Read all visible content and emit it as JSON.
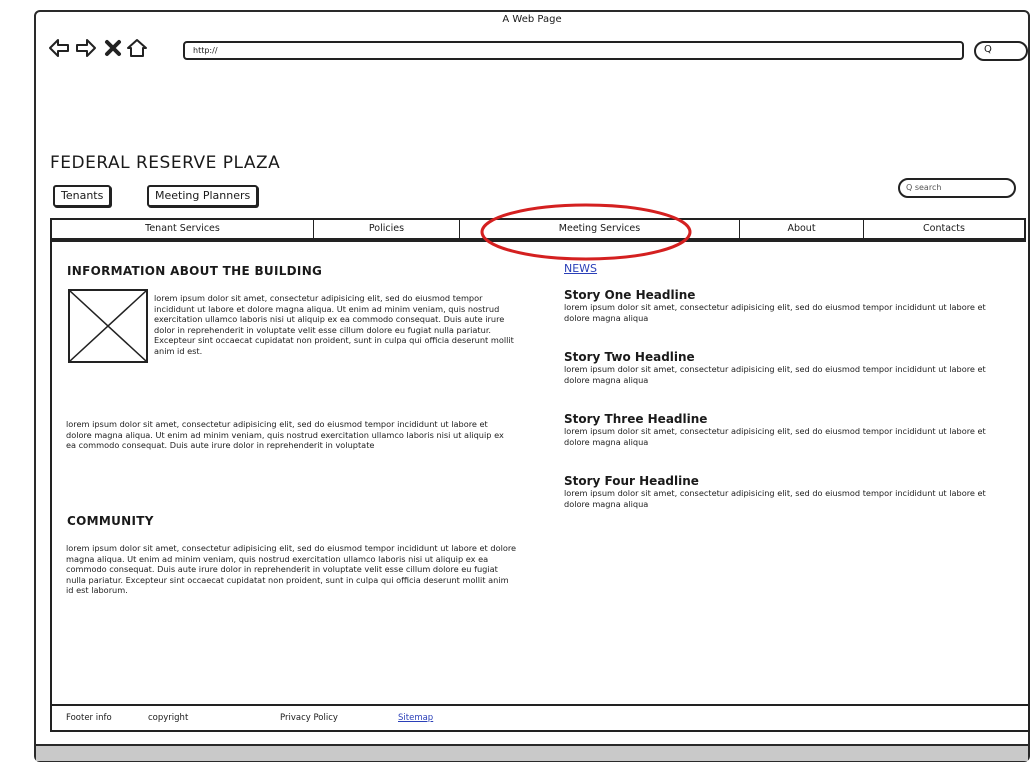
{
  "browser": {
    "window_title": "A Web Page",
    "url_value": "http://",
    "go_label": "Q"
  },
  "site": {
    "title": "FEDERAL RESERVE PLAZA",
    "pills": [
      "Tenants",
      "Meeting Planners"
    ],
    "search_placeholder": "Q search"
  },
  "nav": {
    "items": [
      "Tenant Services",
      "Policies",
      "Meeting Services",
      "About",
      "Contacts"
    ],
    "highlighted": "Meeting Services",
    "highlight_color": "#d42020"
  },
  "building": {
    "heading": "INFORMATION ABOUT THE BUILDING",
    "para1": "lorem ipsum dolor sit amet, consectetur adipisicing elit, sed do eiusmod tempor incididunt ut labore et dolore magna aliqua. Ut enim ad minim veniam, quis nostrud exercitation ullamco laboris nisi ut aliquip ex ea commodo consequat. Duis aute irure dolor in reprehenderit in voluptate velit esse cillum dolore eu fugiat nulla pariatur. Excepteur sint occaecat cupidatat non proident, sunt in culpa qui officia deserunt mollit anim id est.",
    "para2": "lorem ipsum dolor sit amet, consectetur adipisicing elit, sed do eiusmod tempor incididunt ut labore et dolore magna aliqua. Ut enim ad minim veniam, quis nostrud exercitation ullamco laboris nisi ut aliquip ex ea commodo consequat. Duis aute irure dolor in reprehenderit in voluptate"
  },
  "community": {
    "heading": "COMMUNITY",
    "para": "lorem ipsum dolor sit amet, consectetur adipisicing elit, sed do eiusmod tempor incididunt ut labore et dolore magna aliqua. Ut enim ad minim veniam, quis nostrud exercitation ullamco laboris nisi ut aliquip ex ea commodo consequat. Duis aute irure dolor in reprehenderit in voluptate velit esse cillum dolore eu fugiat nulla pariatur. Excepteur sint occaecat cupidatat non proident, sunt in culpa qui officia deserunt mollit anim id est laborum."
  },
  "news": {
    "label": "NEWS",
    "stories": [
      {
        "headline": "Story One Headline",
        "body": "lorem ipsum dolor sit amet, consectetur adipisicing elit, sed do eiusmod tempor incididunt ut labore et dolore magna aliqua"
      },
      {
        "headline": "Story Two Headline",
        "body": "lorem ipsum dolor sit amet, consectetur adipisicing elit, sed do eiusmod tempor incididunt ut labore et dolore magna aliqua"
      },
      {
        "headline": "Story Three Headline",
        "body": "lorem ipsum dolor sit amet, consectetur adipisicing elit, sed do eiusmod tempor incididunt ut labore et dolore magna aliqua"
      },
      {
        "headline": "Story Four Headline",
        "body": "lorem ipsum dolor sit amet, consectetur adipisicing elit, sed do eiusmod tempor incididunt ut labore et dolore magna aliqua"
      }
    ]
  },
  "footer": {
    "info": "Footer info",
    "copyright": "copyright",
    "privacy": "Privacy Policy",
    "sitemap": "Sitemap"
  }
}
